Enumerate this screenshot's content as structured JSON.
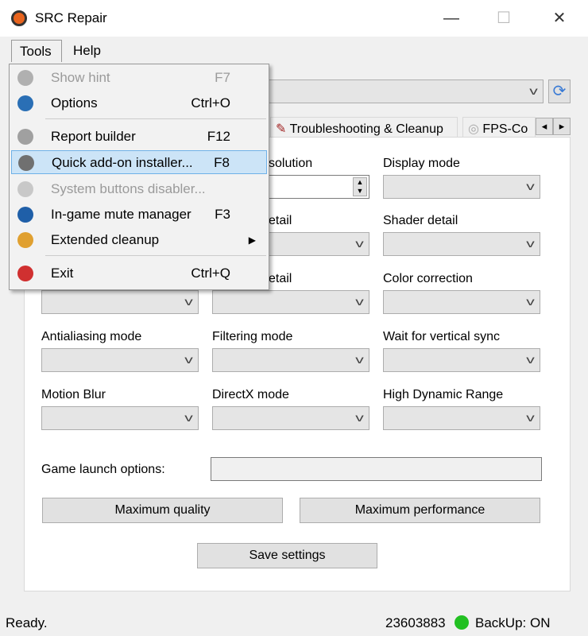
{
  "window": {
    "title": "SRC Repair",
    "minimize": "—",
    "maximize": "☐",
    "close": "✕"
  },
  "menubar": {
    "tools": "Tools",
    "help": "Help"
  },
  "tools_menu": [
    {
      "label": "Show hint",
      "shortcut": "F7",
      "disabled": true,
      "icon": "help-icon",
      "color": "#b0b0b0"
    },
    {
      "label": "Options",
      "shortcut": "Ctrl+O",
      "icon": "gear-icon",
      "color": "#2a6fb5"
    },
    {
      "label": "Report builder",
      "shortcut": "F12",
      "icon": "report-icon",
      "color": "#a0a0a0"
    },
    {
      "label": "Quick add-on installer...",
      "shortcut": "F8",
      "highlighted": true,
      "icon": "installer-icon",
      "color": "#707070"
    },
    {
      "label": "System buttons disabler...",
      "shortcut": "",
      "disabled": true,
      "icon": "keyboard-icon",
      "color": "#c8c8c8"
    },
    {
      "label": "In-game mute manager",
      "shortcut": "F3",
      "icon": "mute-icon",
      "color": "#1f5fa8"
    },
    {
      "label": "Extended cleanup",
      "shortcut": "▶",
      "icon": "broom-icon",
      "color": "#e0a030"
    },
    {
      "label": "Exit",
      "shortcut": "Ctrl+Q",
      "icon": "exit-icon",
      "color": "#d03030"
    }
  ],
  "tabs": {
    "troubleshooting": "Troubleshooting & Cleanup",
    "fps": "FPS-Co",
    "scroll_left": "◂",
    "scroll_right": "▸"
  },
  "settings": {
    "row1": [
      "",
      "solution",
      "Display mode"
    ],
    "row2": [
      "",
      "etail",
      "Shader detail"
    ],
    "row3": [
      "",
      "etail",
      "Color correction"
    ],
    "row4": [
      "Antialiasing mode",
      "Filtering mode",
      "Wait for vertical sync"
    ],
    "row5": [
      "Motion Blur",
      "DirectX mode",
      "High Dynamic Range"
    ]
  },
  "launch_options_label": "Game launch options:",
  "launch_options_value": "",
  "buttons": {
    "max_quality": "Maximum quality",
    "max_performance": "Maximum performance",
    "save": "Save settings"
  },
  "status": {
    "text": "Ready.",
    "id": "23603883",
    "backup": "BackUp: ON",
    "backup_color": "#22c022"
  }
}
